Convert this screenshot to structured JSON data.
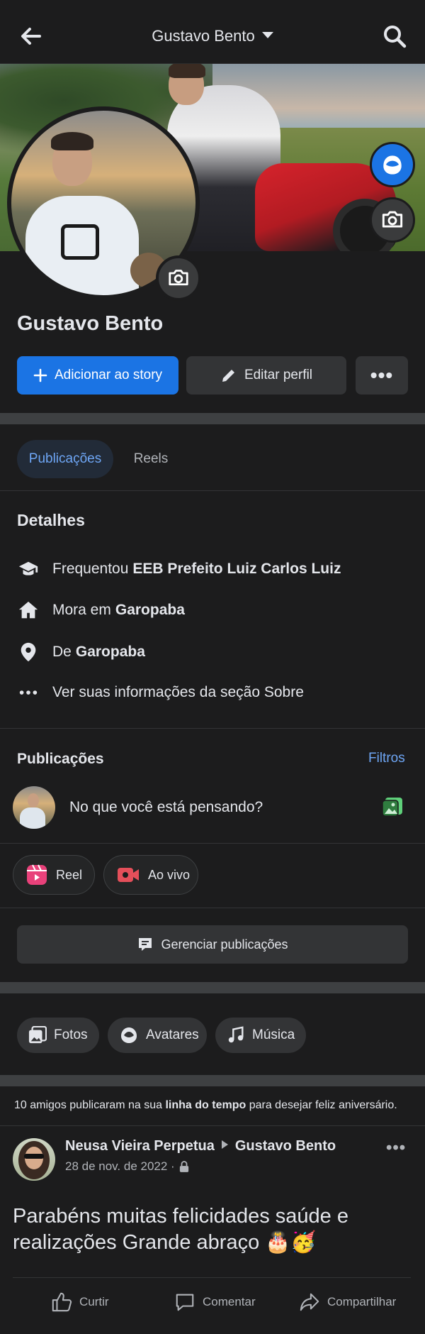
{
  "header": {
    "title": "Gustavo Bento"
  },
  "profile": {
    "name": "Gustavo Bento",
    "add_story_label": "Adicionar ao story",
    "edit_profile_label": "Editar perfil",
    "more_label": "•••"
  },
  "tabs": [
    {
      "label": "Publicações",
      "active": true
    },
    {
      "label": "Reels",
      "active": false
    }
  ],
  "details": {
    "title": "Detalhes",
    "items": [
      {
        "prefix": "Frequentou",
        "value": "EEB Prefeito Luiz Carlos Luiz",
        "icon": "graduation-cap-icon"
      },
      {
        "prefix": "Mora em",
        "value": "Garopaba",
        "icon": "home-icon"
      },
      {
        "prefix": "De",
        "value": "Garopaba",
        "icon": "location-pin-icon"
      },
      {
        "prefix": "Ver suas informações da seção Sobre",
        "value": "",
        "icon": "more-dots-icon"
      }
    ]
  },
  "posts_section": {
    "title": "Publicações",
    "filters_label": "Filtros",
    "composer_placeholder": "No que você está pensando?",
    "reel_label": "Reel",
    "live_label": "Ao vivo",
    "manage_label": "Gerenciar publicações"
  },
  "media_pills": [
    {
      "label": "Fotos"
    },
    {
      "label": "Avatares"
    },
    {
      "label": "Música"
    }
  ],
  "birthday": {
    "count_text": "10 amigos publicaram na sua",
    "link_text": "linha do tempo",
    "suffix_text": "para desejar feliz aniversário."
  },
  "post": {
    "author": "Neusa Vieira Perpetua",
    "target": "Gustavo Bento",
    "date": "28 de nov. de 2022 ·",
    "text": "Parabéns muitas felicidades saúde e realizações Grande abraço 🎂🥳",
    "actions": {
      "like": "Curtir",
      "comment": "Comentar",
      "share": "Compartilhar"
    }
  },
  "colors": {
    "background": "#1c1c1d",
    "accent": "#1b74e4",
    "link": "#6ea6f5",
    "secondary_button": "#333436"
  }
}
